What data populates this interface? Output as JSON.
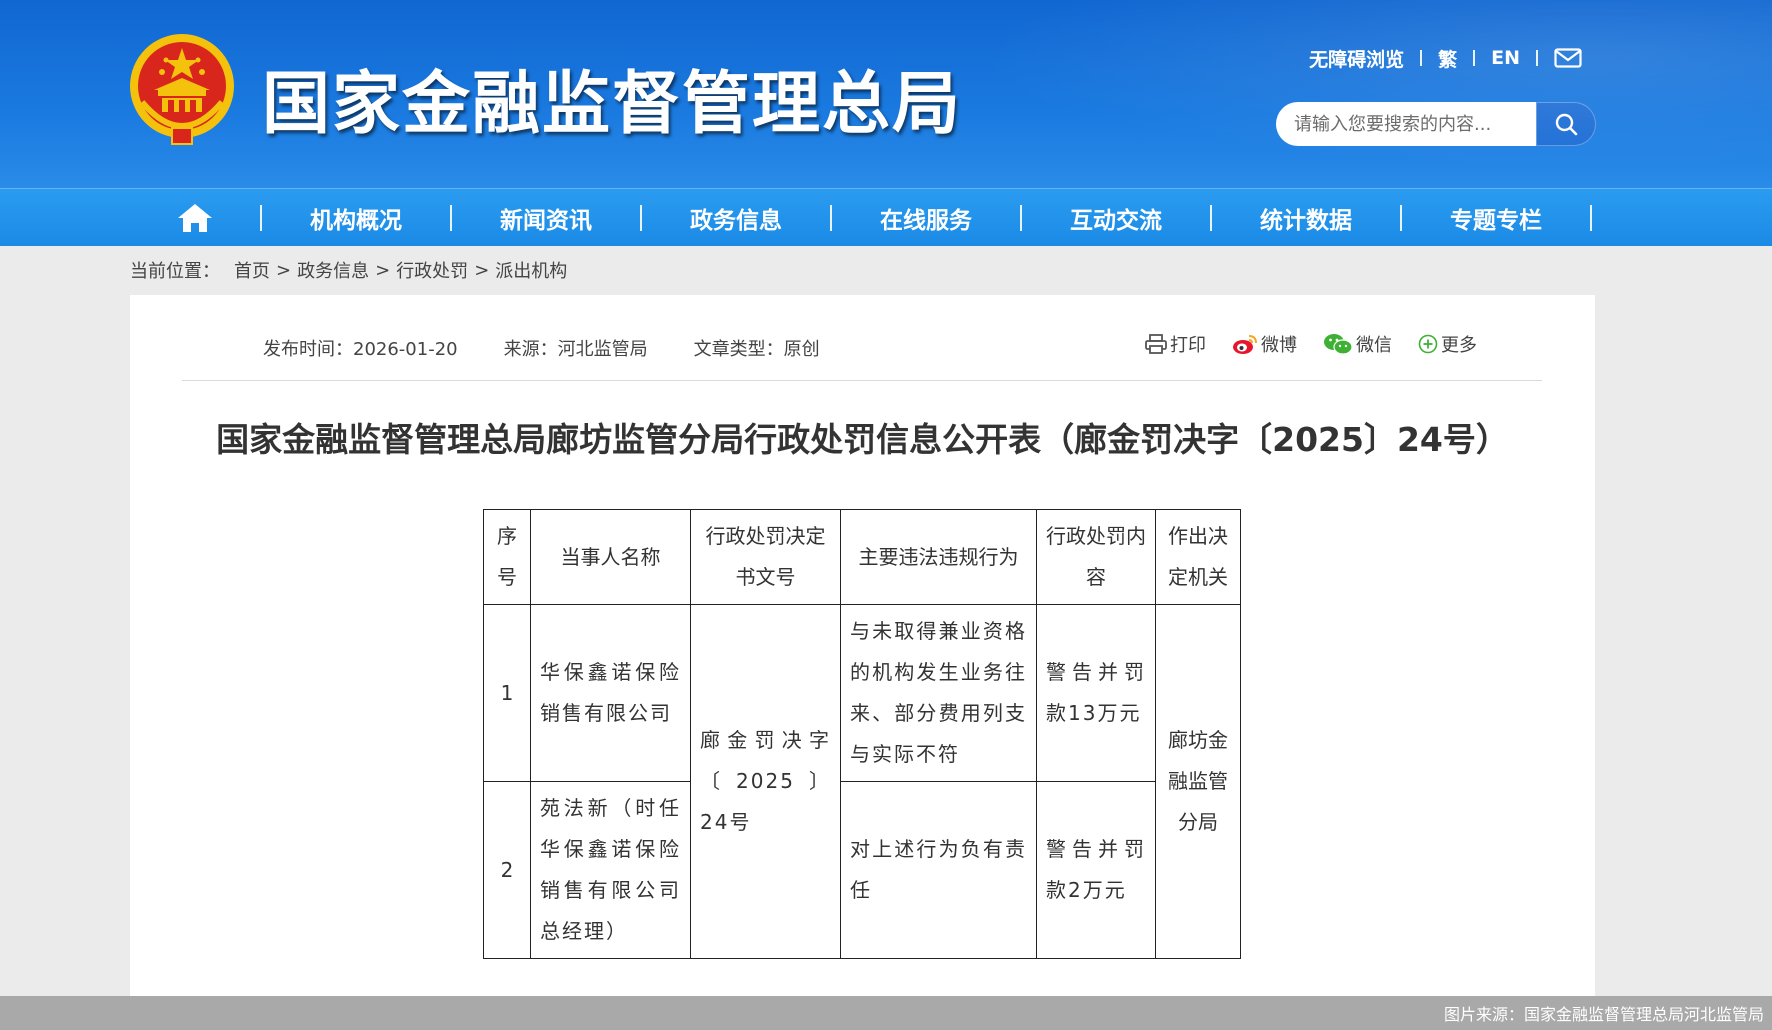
{
  "header": {
    "site_title": "国家金融监督管理总局",
    "links": [
      "无障碍浏览",
      "繁",
      "EN"
    ],
    "search_placeholder": "请输入您要搜索的内容..."
  },
  "nav": {
    "items": [
      "机构概况",
      "新闻资讯",
      "政务信息",
      "在线服务",
      "互动交流",
      "统计数据",
      "专题专栏"
    ]
  },
  "breadcrumb": {
    "label": "当前位置：",
    "items": [
      "首页",
      "政务信息",
      "行政处罚",
      "派出机构"
    ],
    "sep": ">"
  },
  "article": {
    "publish_time": "发布时间：2026-01-20",
    "source": "来源：河北监管局",
    "type": "文章类型：原创",
    "share": {
      "print": "打印",
      "weibo": "微博",
      "wechat": "微信",
      "more": "更多"
    },
    "title": "国家金融监督管理总局廊坊监管分局行政处罚信息公开表（廊金罚决字〔2025〕24号）"
  },
  "table": {
    "headers": [
      "序号",
      "当事人名称",
      "行政处罚决定书文号",
      "主要违法违规行为",
      "行政处罚内容",
      "作出决定机关"
    ],
    "rows": [
      {
        "no": "1",
        "name": "华保鑫诺保险销售有限公司",
        "act": "与未取得兼业资格的机构发生业务往来、部分费用列支与实际不符",
        "penalty": "警告并罚款13万元"
      },
      {
        "no": "2",
        "name": "苑法新（时任华保鑫诺保险销售有限公司总经理）",
        "act": "对上述行为负有责任",
        "penalty": "警告并罚款2万元"
      }
    ],
    "doc_no": "廊金罚决字〔2025〕24号",
    "org": "廊坊金融监管分局"
  },
  "footer": {
    "image_source": "图片来源：国家金融监督管理总局河北监管局"
  },
  "colors": {
    "header_blue": "#1167d1",
    "nav_blue": "#1b8ae6",
    "emblem_red": "#d8261c",
    "emblem_gold": "#f4c20d"
  }
}
